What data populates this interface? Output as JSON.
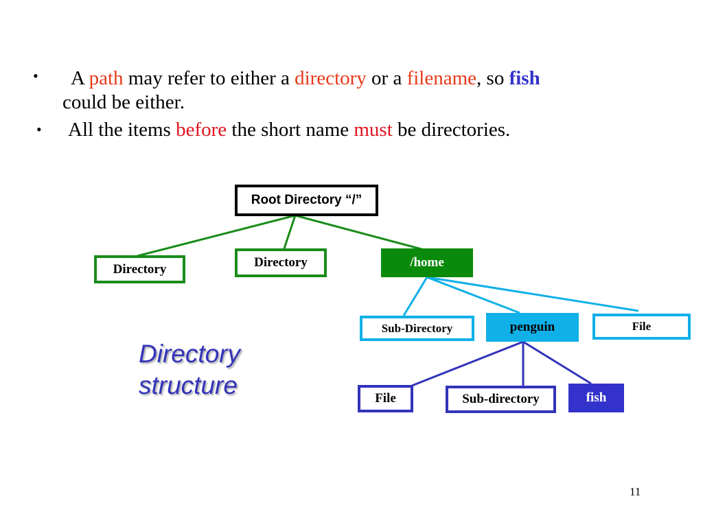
{
  "bullets": [
    {
      "parts": [
        {
          "text": "A ",
          "style": "plain"
        },
        {
          "text": "path",
          "style": "red"
        },
        {
          "text": " may refer to either a ",
          "style": "plain"
        },
        {
          "text": "directory",
          "style": "red"
        },
        {
          "text": " or a ",
          "style": "plain"
        },
        {
          "text": "filename",
          "style": "red"
        },
        {
          "text": ", so ",
          "style": "plain"
        },
        {
          "text": "fish",
          "style": "blue-bold"
        }
      ],
      "continuation": "could be either."
    },
    {
      "parts": [
        {
          "text": "All the items ",
          "style": "plain"
        },
        {
          "text": "before",
          "style": "red"
        },
        {
          "text": " the short name ",
          "style": "plain"
        },
        {
          "text": "must",
          "style": "red"
        },
        {
          "text": " be directories.",
          "style": "plain"
        }
      ]
    }
  ],
  "bullet_symbol": "•",
  "tree": {
    "root": "Root Directory “/”",
    "level1": [
      "Directory",
      "Directory",
      "/home"
    ],
    "level2": [
      "Sub-Directory",
      "penguin",
      "File"
    ],
    "level3": [
      "File",
      "Sub-directory",
      "fish"
    ]
  },
  "caption": {
    "line1": "Directory",
    "line2": "structure"
  },
  "page_number": "11",
  "colors": {
    "green": "#1a8c1a",
    "cyan": "#10b0e8",
    "blue": "#3333cc",
    "red": "#e8391a"
  }
}
